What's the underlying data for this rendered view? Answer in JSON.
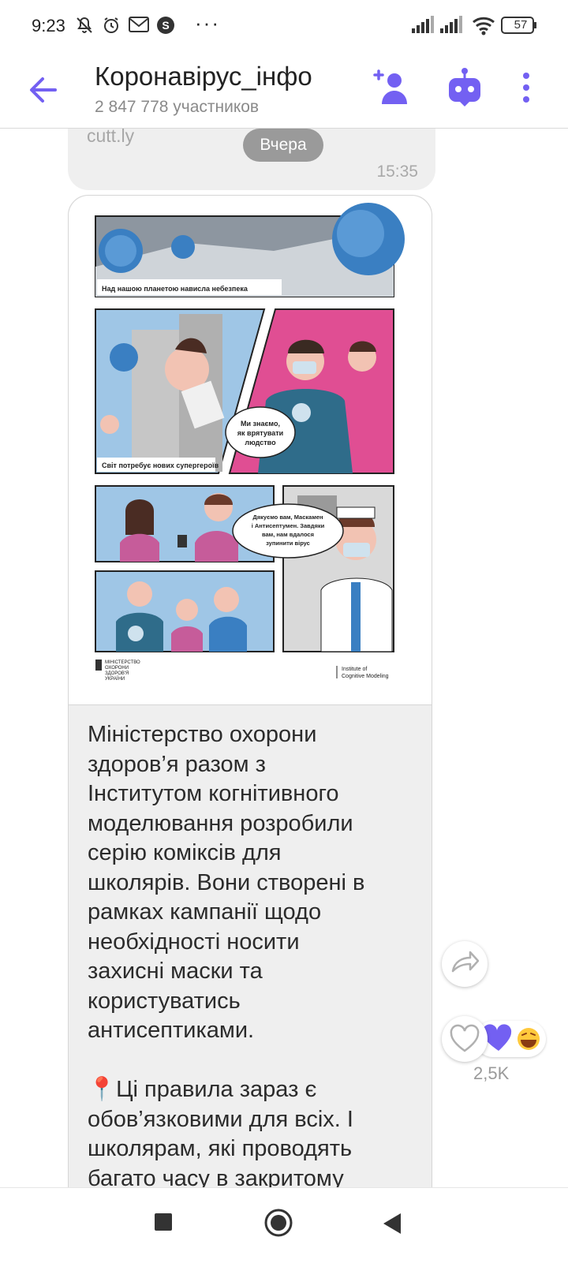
{
  "status_bar": {
    "time": "9:23",
    "battery": "57",
    "icons": [
      "mute-icon",
      "alarm-icon",
      "gmail-icon",
      "skype-icon",
      "more-dots",
      "signal-icon",
      "signal-icon",
      "wifi-icon",
      "battery-icon"
    ]
  },
  "header": {
    "title": "Коронавірус_інфо",
    "subtitle": "2 847 778 участников",
    "icons": [
      "back-arrow-icon",
      "add-participant-icon",
      "bot-icon",
      "more-vert-icon"
    ]
  },
  "messages": {
    "prev": {
      "link_text": "cutt.ly",
      "time": "15:35"
    },
    "date_chip": "Вчера",
    "main": {
      "comic": {
        "panel1_caption": "Над нашою планетою нависла небезпека",
        "panel2_caption": "Світ потребує нових супергероїв",
        "speech1": "Ми знаємо,\nяк врятувати\nлюдство",
        "speech2": "Дякуємо вам, Маскамен\nі Антисептумен. Завдяки\nвам, нам вдалося\nзупинити вірус",
        "footer_left": "МІНІСТЕРСТВО\nОХОРОНИ\nЗДОРОВ'Я\nУКРАЇНИ",
        "footer_right": "Institute of\nCognitive Modeling"
      },
      "text": "Міністерство охорони\nздоров’я разом з\nІнститутом когнітивного\nмоделювання розробили\nсерію коміксів для\nшколярів. Вони створені в\nрамках кампанії щодо\nнеобхідності носити\nзахисні маски та\nкористуватись\nантисептиками.\n\n📍Ці правила зараз є\nобов’язковими для всіх. І\nшколярам, які проводять\nбагато часу в закритому"
    }
  },
  "side_actions": {
    "reaction_count": "2,5K",
    "reaction_emojis": [
      "purple-heart",
      "laughing-emoji"
    ]
  },
  "nav": [
    "recents-square-icon",
    "home-circle-icon",
    "back-triangle-icon"
  ],
  "colors": {
    "accent": "#7360f2",
    "bubble": "#efefef",
    "date_chip": "#9a9a9a"
  }
}
